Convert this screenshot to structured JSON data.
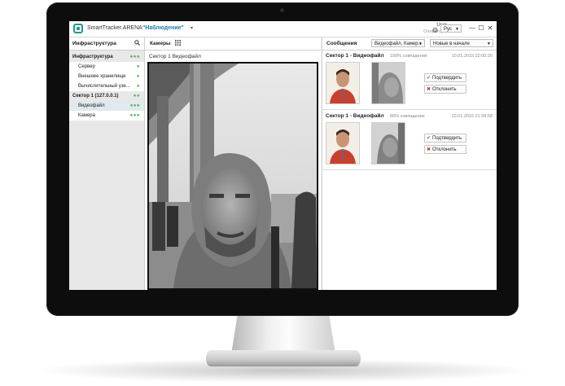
{
  "header": {
    "app_title": "SmartTracker.ARENA",
    "mode_title": "\"Наблюдение\"",
    "mode_caret": "▾",
    "user_name": "User",
    "user_role": "Операторы",
    "language": "Рус"
  },
  "window_controls": {
    "minimize": "—",
    "maximize": "☐",
    "close": "✕"
  },
  "left_panel": {
    "title": "Инфраструктура",
    "items": [
      {
        "label": "Инфраструктура",
        "dots": "●●●"
      },
      {
        "label": "Сервер",
        "dots": "●"
      },
      {
        "label": "Внешнее хранилище",
        "dots": "●"
      },
      {
        "label": "Вычислительный узе...",
        "dots": "●"
      },
      {
        "label": "Сектор 1 (127.0.0.1)",
        "dots": "●●"
      },
      {
        "label": "Видеофайл",
        "dots": "●●●"
      },
      {
        "label": "Камера",
        "dots": "●●●"
      }
    ]
  },
  "center_panel": {
    "title": "Камеры",
    "tile_title": "Сектор 1 Видеофайл"
  },
  "right_panel": {
    "title": "Сообщения",
    "filter_dropdown": "Видеофайл, Камер...",
    "sort_dropdown": "Новые в начале",
    "events": [
      {
        "title": "Сектор 1 - Видеофайл",
        "match": "100% совпадение",
        "time": "10.01.2015 22:00:20",
        "confirm": "Подтвердить",
        "reject": "Отклонить"
      },
      {
        "title": "Сектор 1 - Видеофайл",
        "match": "80% совпадение",
        "time": "10.01.2015 21:58:58",
        "confirm": "Подтвердить",
        "reject": "Отклонить"
      }
    ]
  },
  "colors": {
    "accent": "#1b7fa8",
    "status_green": "#49b24a",
    "reject_red": "#c0392b"
  }
}
